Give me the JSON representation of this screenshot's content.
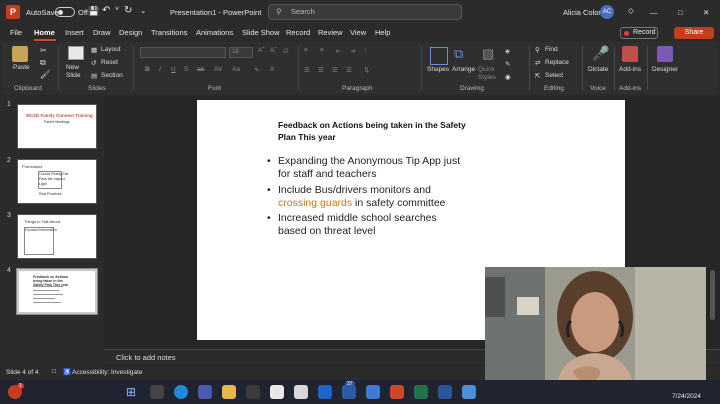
{
  "titlebar": {
    "app_logo": "P",
    "autosave_label": "AutoSave",
    "autosave_state": "Off",
    "window_title": "Presentation1 - PowerPoint",
    "search_placeholder": "Search",
    "user_name": "Alicia Colon",
    "user_initials": "AC"
  },
  "menu": {
    "tabs": [
      "File",
      "Home",
      "Insert",
      "Draw",
      "Design",
      "Transitions",
      "Animations",
      "Slide Show",
      "Record",
      "Review",
      "View",
      "Help"
    ],
    "active_tab": "Home",
    "record_label": "Record",
    "share_label": "Share"
  },
  "ribbon": {
    "paste": "Paste",
    "new_slide": "New Slide",
    "layout": "Layout",
    "reset": "Reset",
    "section": "Section",
    "font_size": "18",
    "shapes": "Shapes",
    "arrange": "Arrange",
    "quick_styles": "Quick Styles",
    "find": "Find",
    "replace": "Replace",
    "select": "Select",
    "dictate": "Dictate",
    "addins": "Add-ins",
    "designer": "Designer",
    "groups": {
      "clipboard": "Clipboard",
      "slides": "Slides",
      "font": "Font",
      "paragraph": "Paragraph",
      "drawing": "Drawing",
      "editing": "Editing",
      "voice": "Voice",
      "addins": "Add-ins"
    }
  },
  "thumbnails": [
    {
      "number": "1",
      "title": "MCSD Family Connect Training",
      "subtitle": "Parent Meetings"
    },
    {
      "number": "2",
      "title": "Promotions",
      "lines": [
        "Course Ready-Fail",
        "Pass the Inspect",
        "Light",
        "Rest Practices"
      ]
    },
    {
      "number": "3",
      "title": "Things to Talk About",
      "lines": [
        "Focused Information"
      ]
    },
    {
      "number": "4",
      "title": "Feedback on Actions being taken in the Safety Plan This year"
    }
  ],
  "slide": {
    "title": "Feedback on Actions being taken in the Safety Plan This year",
    "bullets": [
      {
        "text": "Expanding the Anonymous Tip App just for staff and teachers"
      },
      {
        "before": "Include Bus/drivers monitors and ",
        "highlight": "crossing guards",
        "after": " in safety committee"
      },
      {
        "text": "Increased middle school searches based on threat level"
      }
    ]
  },
  "notes_placeholder": "Click to add notes",
  "status": {
    "slide_counter": "Slide 4 of 4",
    "accessibility": "Accessibility: Investigate"
  },
  "taskbar": {
    "date": "7/24/2024",
    "badge_count": "37"
  },
  "colors": {
    "accent": "#c43e1c",
    "highlight_text": "#c0782a"
  }
}
